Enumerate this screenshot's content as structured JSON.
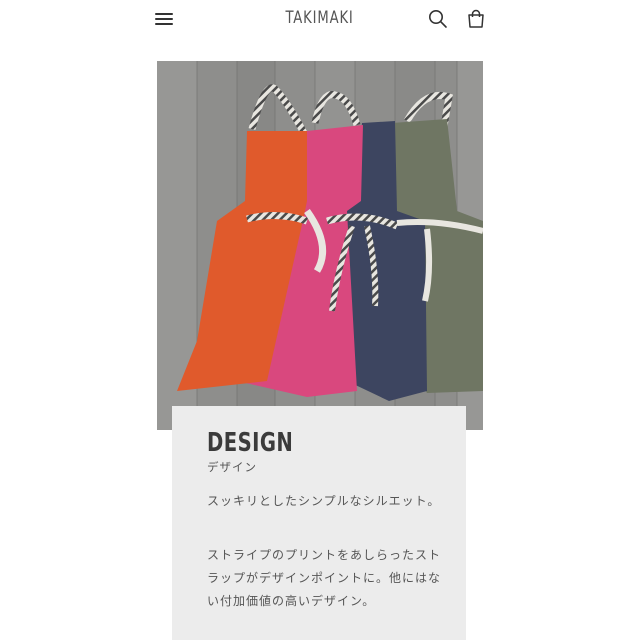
{
  "header": {
    "brand": "TAKIMAKI",
    "icons": [
      "menu-icon",
      "search-icon",
      "cart-icon"
    ]
  },
  "hero": {
    "apron_colors": [
      "#e05a2c",
      "#d9487e",
      "#3d4560",
      "#6f7663"
    ]
  },
  "section": {
    "title": "DESIGN",
    "subtitle": "デザイン",
    "paragraph1": "スッキリとしたシンプルなシルエット。",
    "paragraph2": "ストライプのプリントをあしらったストラップがデザインポイントに。他にはない付加価値の高いデザイン。"
  }
}
